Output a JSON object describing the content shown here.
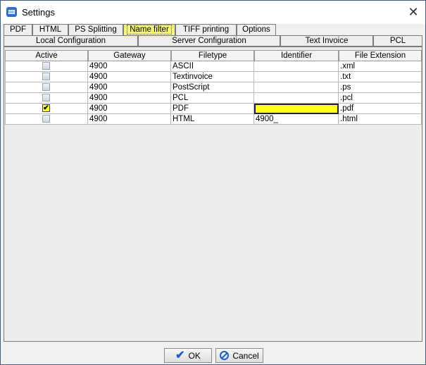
{
  "window": {
    "title": "Settings"
  },
  "tabs_row1": [
    {
      "label": "PDF"
    },
    {
      "label": "HTML"
    },
    {
      "label": "PS Splitting"
    },
    {
      "label": "Name filter",
      "active": true
    },
    {
      "label": "TIFF printing"
    },
    {
      "label": "Options"
    }
  ],
  "tabs_row2": [
    {
      "label": "Local Configuration"
    },
    {
      "label": "Server Configuration"
    },
    {
      "label": "Text Invoice"
    },
    {
      "label": "PCL"
    }
  ],
  "table": {
    "columns": [
      "Active",
      "Gateway",
      "Filetype",
      "Identifier",
      "File Extension"
    ],
    "rows": [
      {
        "active": false,
        "gateway": "4900",
        "filetype": "ASCII",
        "identifier": "",
        "extension": ".xml"
      },
      {
        "active": false,
        "gateway": "4900",
        "filetype": "Textinvoice",
        "identifier": "",
        "extension": ".txt"
      },
      {
        "active": false,
        "gateway": "4900",
        "filetype": "PostScript",
        "identifier": "",
        "extension": ".ps"
      },
      {
        "active": false,
        "gateway": "4900",
        "filetype": "PCL",
        "identifier": "",
        "extension": ".pcl"
      },
      {
        "active": true,
        "gateway": "4900",
        "filetype": "PDF",
        "identifier": "",
        "extension": ".pdf",
        "selected": true
      },
      {
        "active": false,
        "gateway": "4900",
        "filetype": "HTML",
        "identifier": "4900_",
        "extension": ".html"
      }
    ]
  },
  "buttons": {
    "ok": "OK",
    "cancel": "Cancel"
  },
  "icons": {
    "ok": "checkmark-icon",
    "cancel": "cancel-icon",
    "close": "close-icon",
    "app": "app-icon"
  },
  "colors": {
    "highlight": "#ffff1a",
    "accent": "#1f5fbf"
  }
}
